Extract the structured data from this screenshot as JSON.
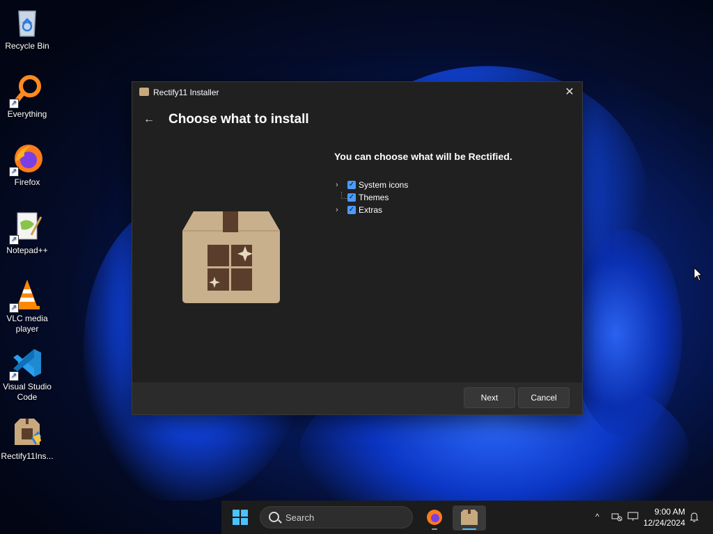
{
  "desktop": {
    "icons": [
      {
        "label": "Recycle Bin"
      },
      {
        "label": "Everything"
      },
      {
        "label": "Firefox"
      },
      {
        "label": "Notepad++"
      },
      {
        "label": "VLC media player"
      },
      {
        "label": "Visual Studio Code"
      },
      {
        "label": "Rectify11Ins..."
      }
    ]
  },
  "window": {
    "title": "Rectify11 Installer",
    "close_glyph": "✕",
    "back_glyph": "←",
    "heading": "Choose what to install",
    "subtitle": "You can choose what will be Rectified.",
    "tree": [
      {
        "label": "System icons",
        "checked": true,
        "expandable": true
      },
      {
        "label": "Themes",
        "checked": true,
        "expandable": false
      },
      {
        "label": "Extras",
        "checked": true,
        "expandable": true
      }
    ],
    "buttons": {
      "next": "Next",
      "cancel": "Cancel"
    }
  },
  "taskbar": {
    "search_placeholder": "Search",
    "clock_time": "9:00 AM",
    "clock_date": "12/24/2024",
    "tray_chevron": "^"
  },
  "colors": {
    "accent": "#4b9bff",
    "window_bg": "#202020",
    "footer_bg": "#2b2b2b",
    "box_tan": "#c8a97e"
  }
}
